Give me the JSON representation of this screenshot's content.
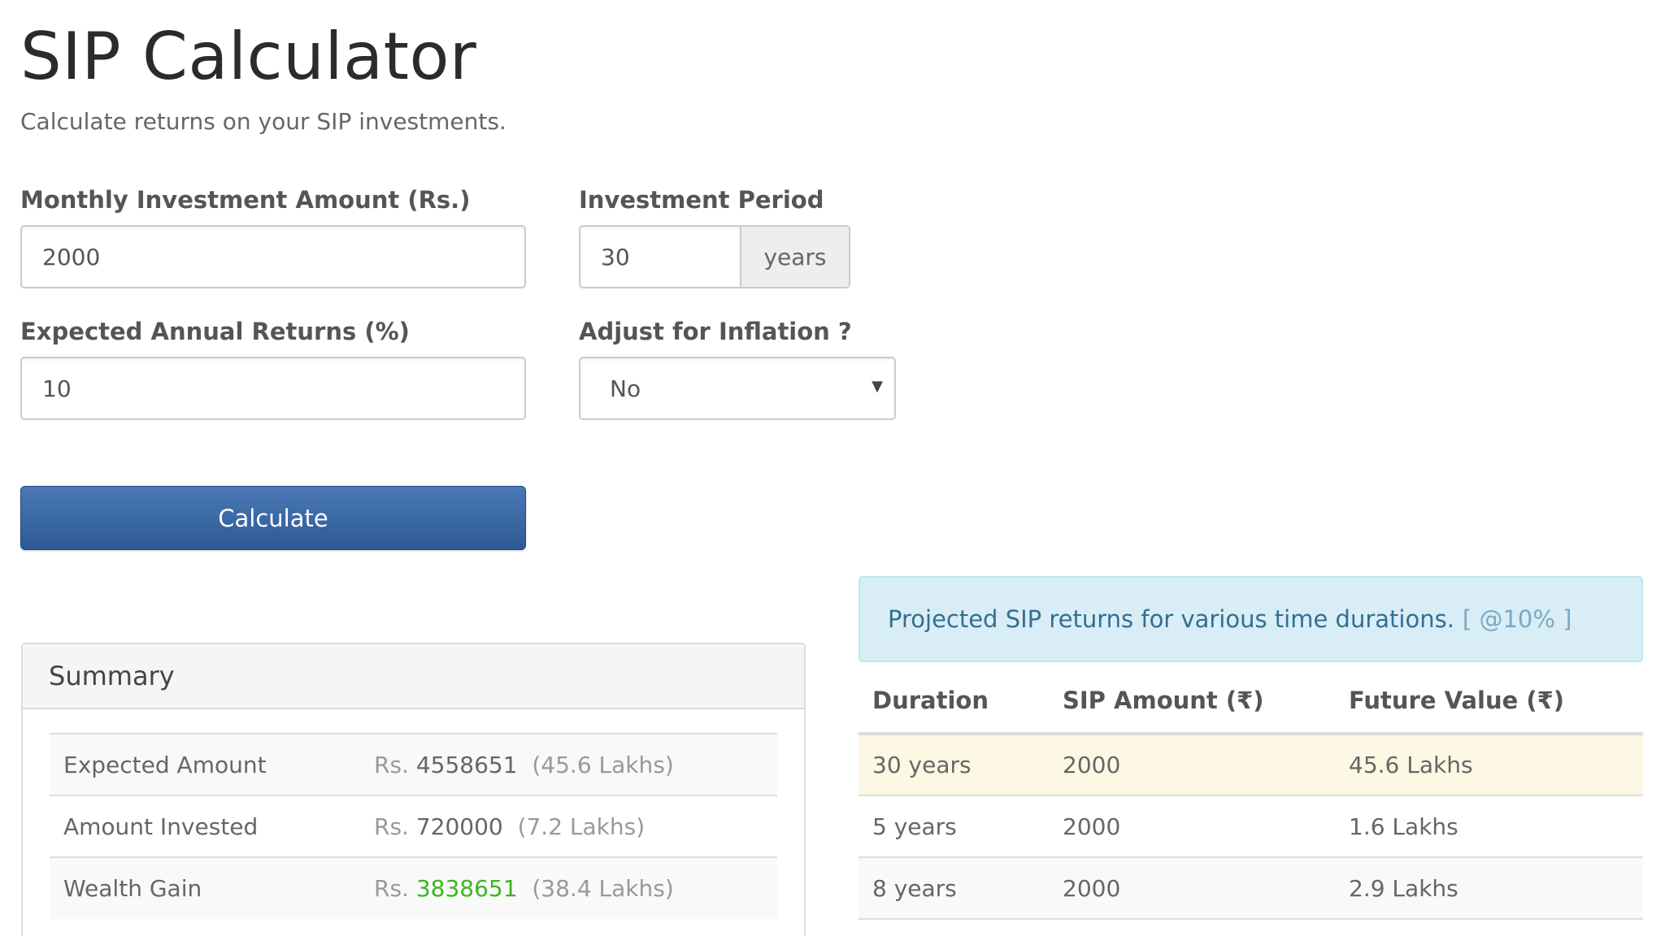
{
  "header": {
    "title": "SIP Calculator",
    "subtitle": "Calculate returns on your SIP investments."
  },
  "form": {
    "monthly_label": "Monthly Investment Amount (Rs.)",
    "monthly_value": "2000",
    "period_label": "Investment Period",
    "period_value": "30",
    "period_unit": "years",
    "returns_label": "Expected Annual Returns (%)",
    "returns_value": "10",
    "inflation_label": "Adjust for Inflation ?",
    "inflation_value": "No",
    "calculate_label": "Calculate"
  },
  "summary": {
    "heading": "Summary",
    "rows": [
      {
        "label": "Expected Amount",
        "prefix": "Rs.",
        "amount": "4558651",
        "lakhs": "(45.6 Lakhs)"
      },
      {
        "label": "Amount Invested",
        "prefix": "Rs.",
        "amount": "720000",
        "lakhs": "(7.2 Lakhs)"
      },
      {
        "label": "Wealth Gain",
        "prefix": "Rs.",
        "amount": "3838651",
        "lakhs": "(38.4 Lakhs)"
      }
    ]
  },
  "projection": {
    "info_text": "Projected SIP returns for various time durations.",
    "info_note": "[ @10% ]",
    "columns": [
      "Duration",
      "SIP Amount (₹)",
      "Future Value (₹)"
    ],
    "rows": [
      [
        "30 years",
        "2000",
        "45.6 Lakhs"
      ],
      [
        "5 years",
        "2000",
        "1.6 Lakhs"
      ],
      [
        "8 years",
        "2000",
        "2.9 Lakhs"
      ]
    ]
  },
  "colors": {
    "primary_button": "#2d5a94",
    "info_background": "#d9edf7",
    "info_text": "#31708f",
    "highlight_row": "#fcf8e3",
    "gain_text": "#3cb521"
  }
}
